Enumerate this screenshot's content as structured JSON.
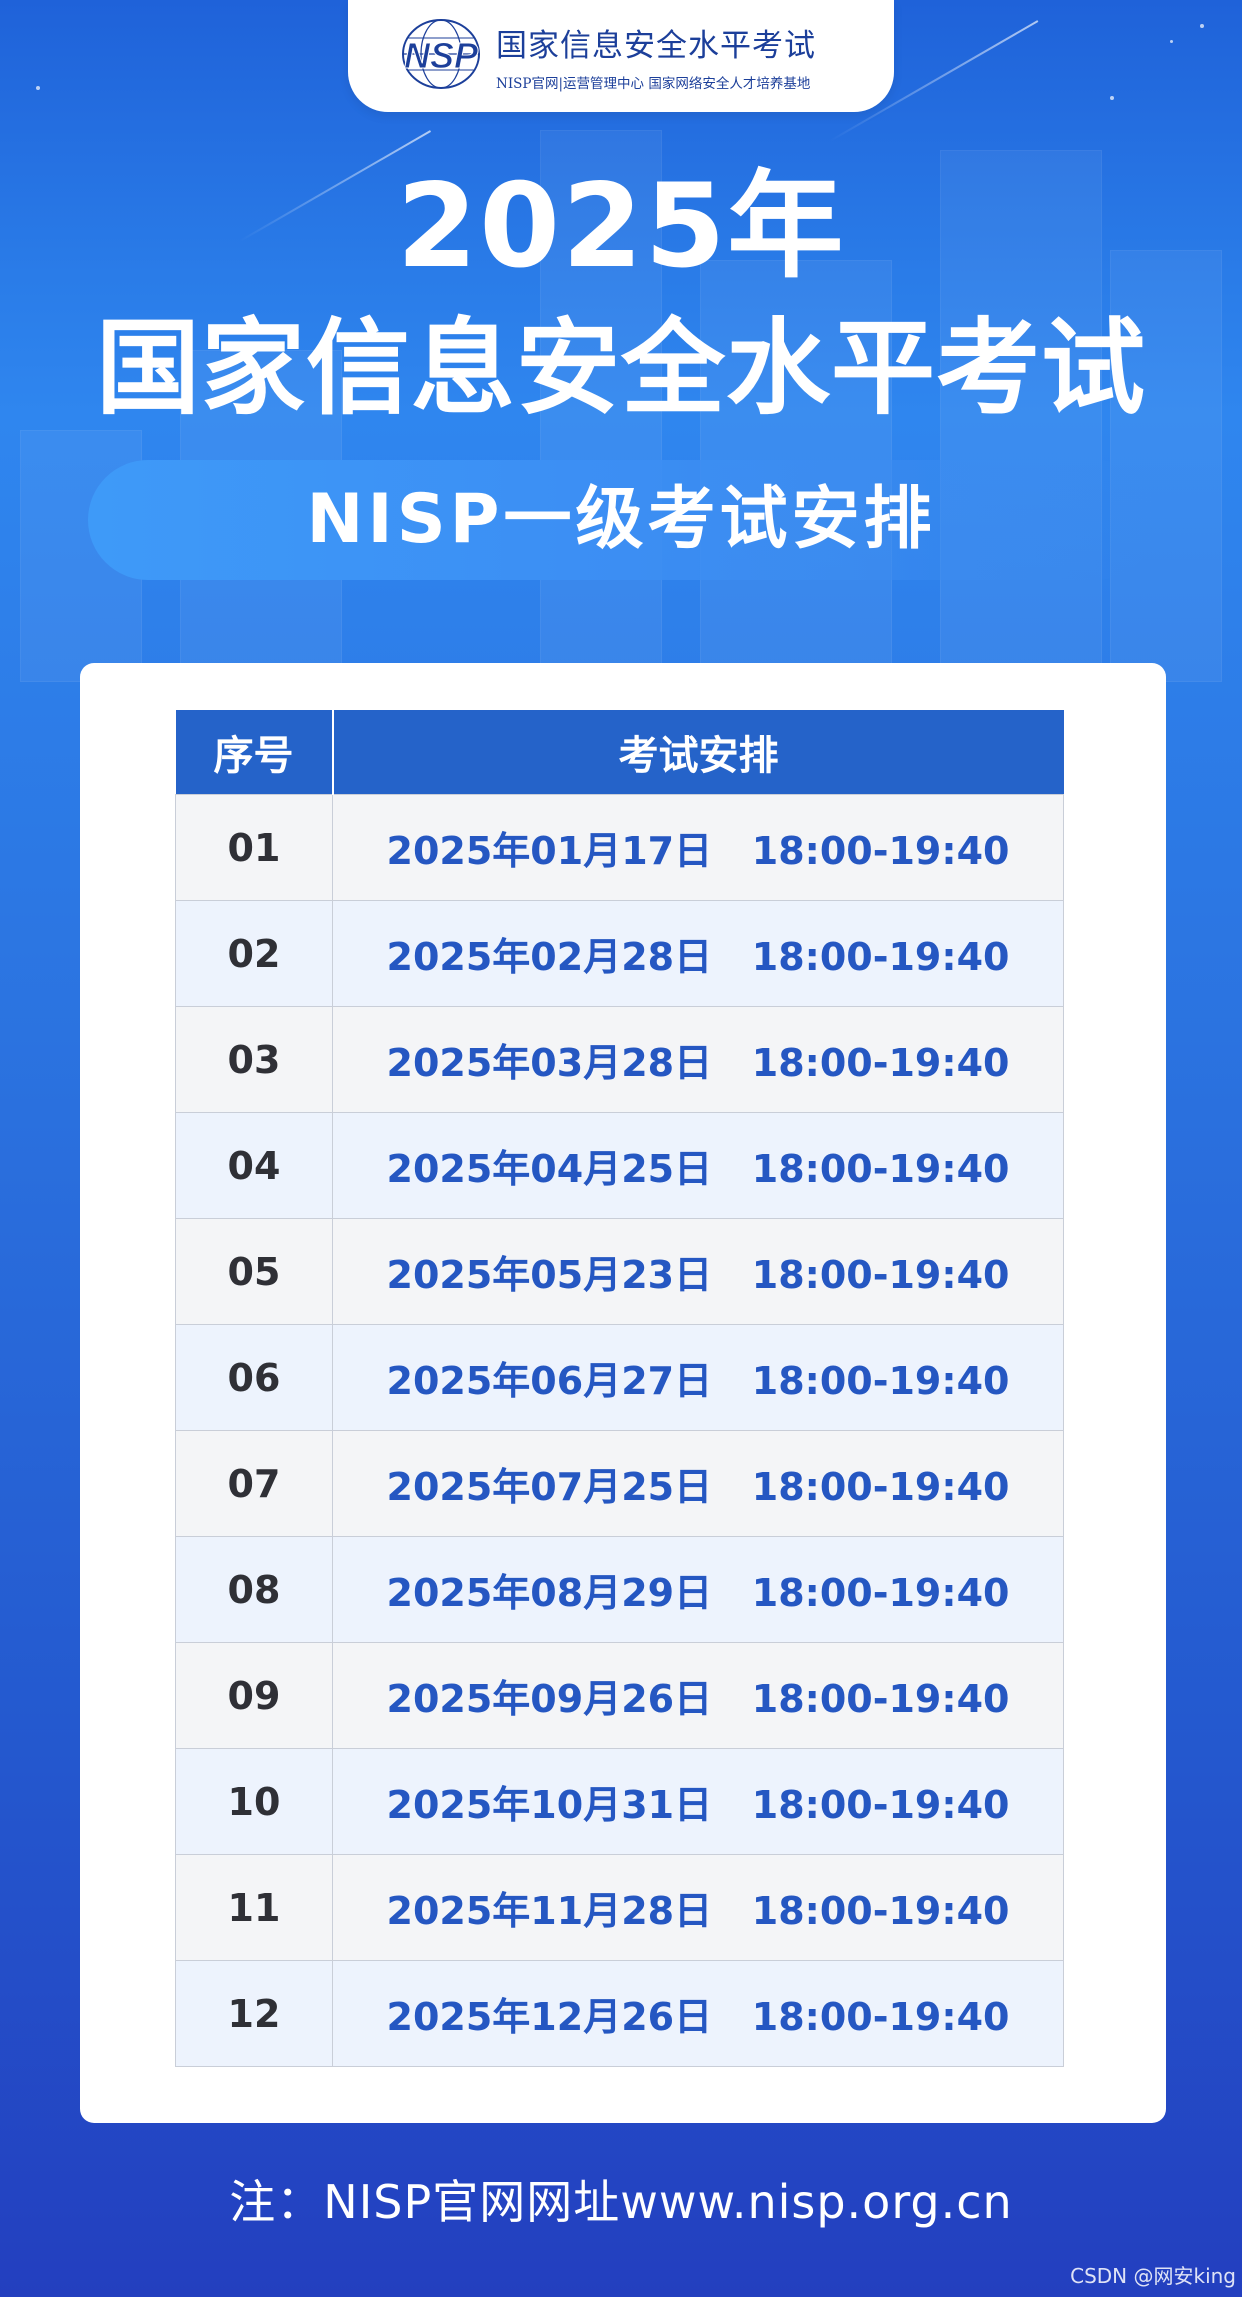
{
  "brand": {
    "logo_text": "NSP",
    "name": "国家信息安全水平考试",
    "sub": "NISP官网|运营管理中心  国家网络安全人才培养基地"
  },
  "title": {
    "year": "2025年",
    "main": "国家信息安全水平考试",
    "subtitle": "NISP一级考试安排"
  },
  "table": {
    "headers": [
      "序号",
      "考试安排"
    ],
    "rows": [
      {
        "index": "01",
        "schedule": "2025年01月17日   18:00-19:40"
      },
      {
        "index": "02",
        "schedule": "2025年02月28日   18:00-19:40"
      },
      {
        "index": "03",
        "schedule": "2025年03月28日   18:00-19:40"
      },
      {
        "index": "04",
        "schedule": "2025年04月25日   18:00-19:40"
      },
      {
        "index": "05",
        "schedule": "2025年05月23日   18:00-19:40"
      },
      {
        "index": "06",
        "schedule": "2025年06月27日   18:00-19:40"
      },
      {
        "index": "07",
        "schedule": "2025年07月25日   18:00-19:40"
      },
      {
        "index": "08",
        "schedule": "2025年08月29日   18:00-19:40"
      },
      {
        "index": "09",
        "schedule": "2025年09月26日   18:00-19:40"
      },
      {
        "index": "10",
        "schedule": "2025年10月31日   18:00-19:40"
      },
      {
        "index": "11",
        "schedule": "2025年11月28日   18:00-19:40"
      },
      {
        "index": "12",
        "schedule": "2025年12月26日   18:00-19:40"
      }
    ]
  },
  "footer": {
    "note": "注：NISP官网网址www.nisp.org.cn",
    "watermark": "CSDN @网安king"
  },
  "colors": {
    "header_blue": "#2563c9",
    "date_blue": "#2557c2",
    "brand_blue": "#1c3f9a"
  }
}
